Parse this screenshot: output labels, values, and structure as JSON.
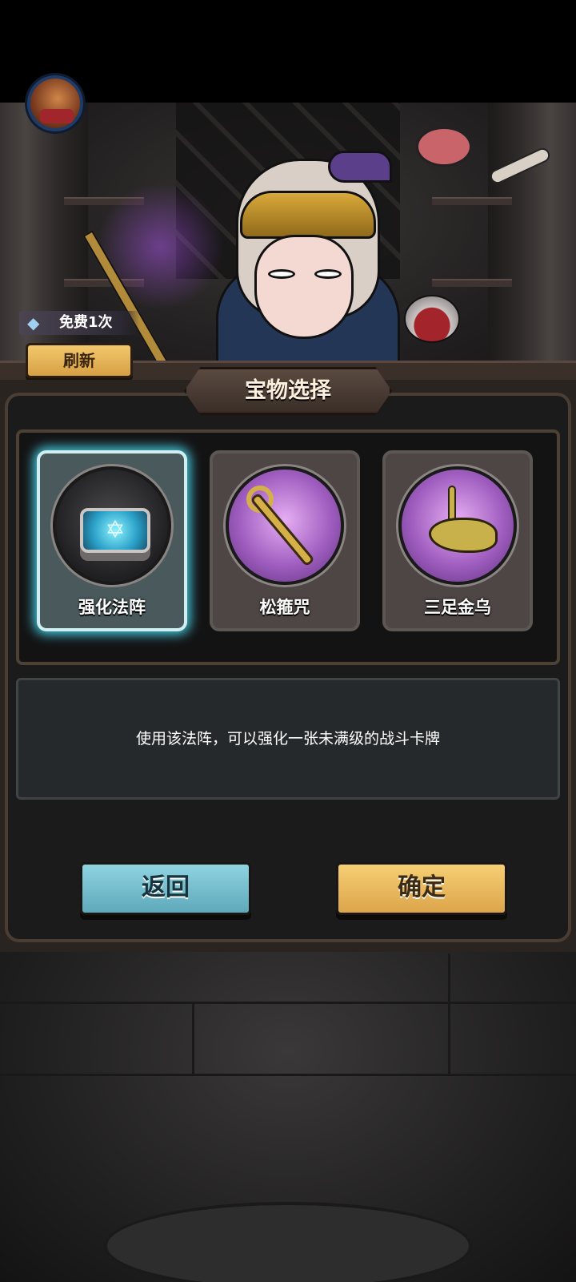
{
  "refresh": {
    "free_label": "免费1次",
    "button_label": "刷新"
  },
  "panel": {
    "title": "宝物选择"
  },
  "items": [
    {
      "name": "强化法阵",
      "selected": true
    },
    {
      "name": "松箍咒",
      "selected": false
    },
    {
      "name": "三足金乌",
      "selected": false
    }
  ],
  "description": "使用该法阵，可以强化一张未满级的战斗卡牌",
  "buttons": {
    "back_label": "返回",
    "confirm_label": "确定"
  },
  "colors": {
    "selected_glow": "#45c9de",
    "back_button": "#8fd3e1",
    "confirm_button": "#f6cf74"
  }
}
